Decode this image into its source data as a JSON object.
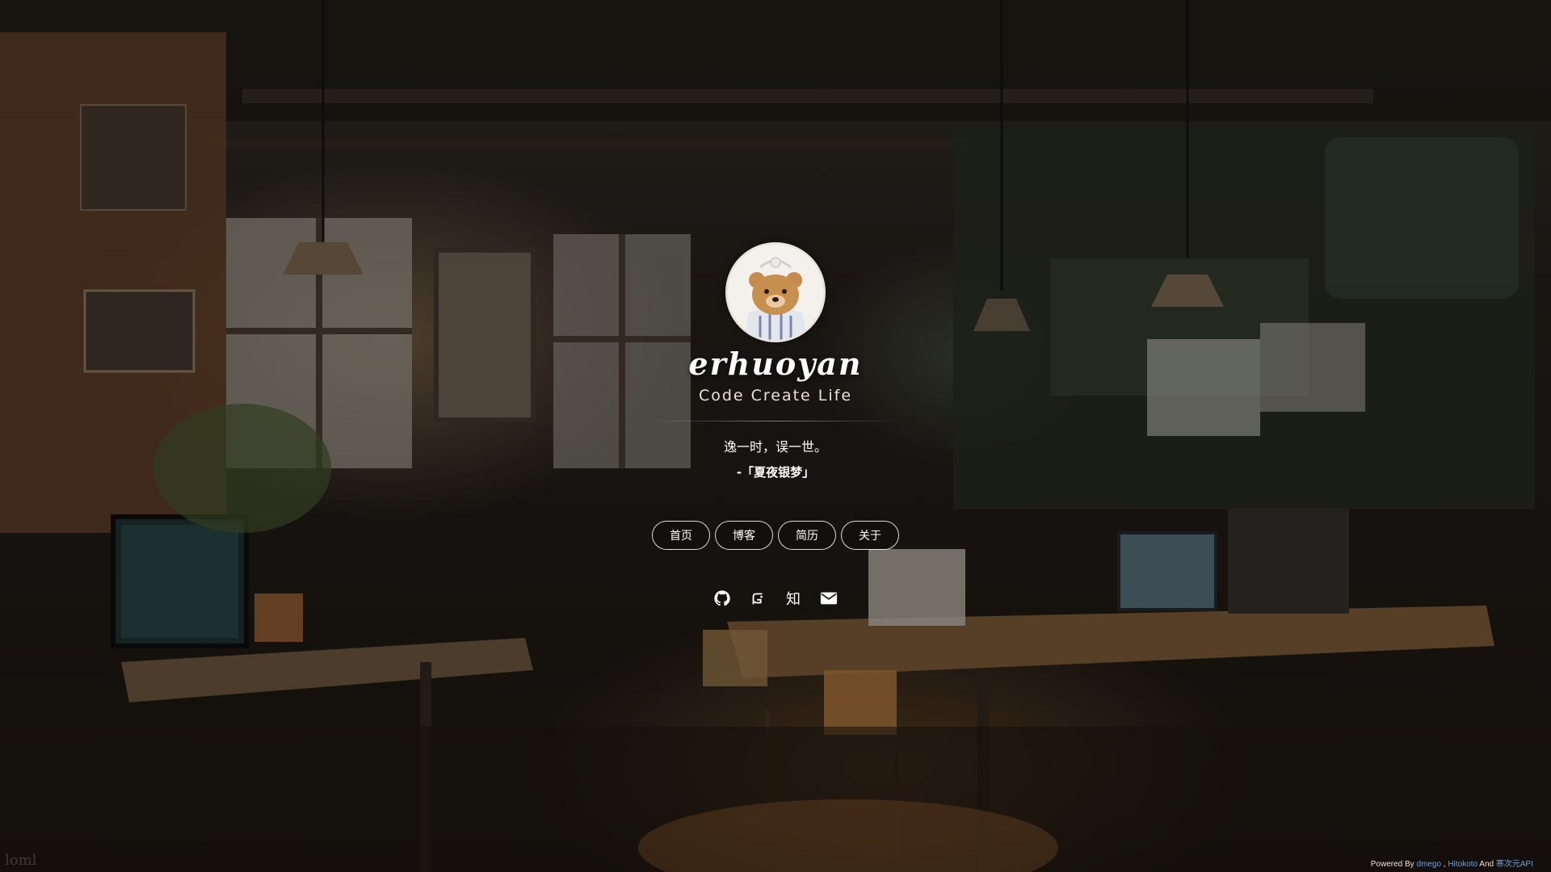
{
  "profile": {
    "name": "erhuoyan",
    "slogan": "Code Create Life"
  },
  "hitokoto": {
    "text": "逸一时，误一世。",
    "source": "-「夏夜银梦」"
  },
  "nav": {
    "items": [
      {
        "label": "首页"
      },
      {
        "label": "博客"
      },
      {
        "label": "简历"
      },
      {
        "label": "关于"
      }
    ]
  },
  "social": {
    "icons": [
      "github-icon",
      "gitee-icon",
      "zhihu-icon",
      "mail-icon"
    ],
    "zhihu_glyph": "知"
  },
  "corner": {
    "text": "loml"
  },
  "footer": {
    "prefix": "Powered By",
    "link1": "dmego",
    "sep1": ",",
    "link2": "Hitokoto",
    "sep2": "And",
    "link3": "寒次元API"
  },
  "colors": {
    "accent_link": "#6fa0d8",
    "text": "#ffffff"
  }
}
